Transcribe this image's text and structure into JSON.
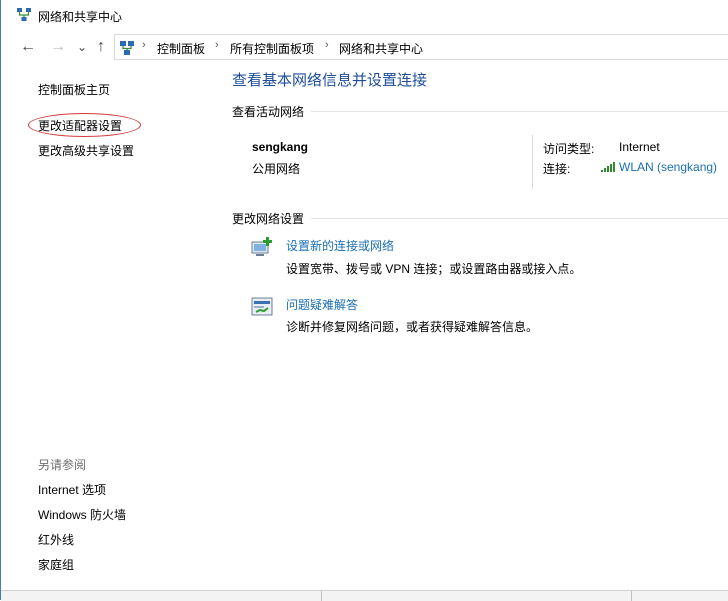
{
  "window": {
    "title": "网络和共享中心"
  },
  "nav": {
    "back_glyph": "←",
    "forward_glyph": "→",
    "dropdown_glyph": "⌄",
    "up_glyph": "↑"
  },
  "address": {
    "crumbs": [
      "控制面板",
      "所有控制面板项",
      "网络和共享中心"
    ]
  },
  "sidebar": {
    "links": [
      "控制面板主页",
      "更改适配器设置",
      "更改高级共享设置"
    ],
    "see_also_heading": "另请参阅",
    "see_also": [
      "Internet 选项",
      "Windows 防火墙",
      "红外线",
      "家庭组"
    ]
  },
  "main": {
    "title": "查看基本网络信息并设置连接",
    "active_heading": "查看活动网络",
    "network": {
      "name": "sengkang",
      "type": "公用网络",
      "access_label": "访问类型:",
      "access_value": "Internet",
      "connection_label": "连接:",
      "connection_value": "WLAN (sengkang)"
    },
    "change_heading": "更改网络设置",
    "tasks": [
      {
        "link": "设置新的连接或网络",
        "desc": "设置宽带、拨号或 VPN 连接；或设置路由器或接入点。",
        "icon": "new-connection-icon"
      },
      {
        "link": "问题疑难解答",
        "desc": "诊断并修复网络问题，或者获得疑难解答信息。",
        "icon": "troubleshoot-icon"
      }
    ]
  },
  "colors": {
    "link": "#1a6fb5",
    "title": "#1e4e9b",
    "highlight": "#d23c3c",
    "window_border": "#3c7fb1"
  }
}
